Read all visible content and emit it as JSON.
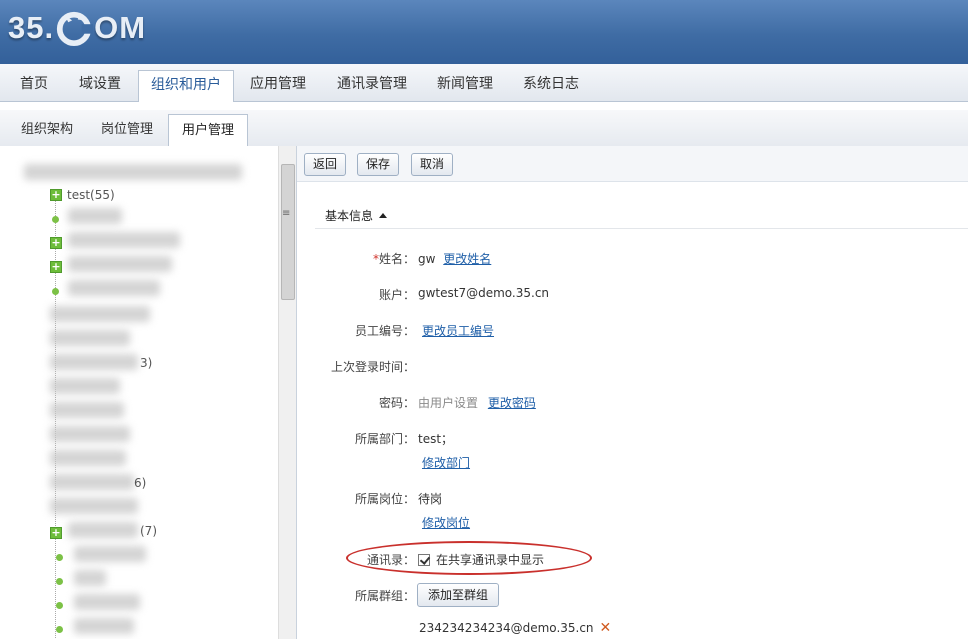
{
  "header": {
    "logo_left": "35.",
    "logo_right": "OM"
  },
  "main_nav": {
    "tabs": [
      "首页",
      "域设置",
      "组织和用户",
      "应用管理",
      "通讯录管理",
      "新闻管理",
      "系统日志"
    ],
    "active_index": 2
  },
  "sub_nav": {
    "tabs": [
      "组织架构",
      "岗位管理",
      "用户管理"
    ],
    "active_index": 2
  },
  "tree": {
    "visible_node": "test(55)",
    "partial_counts": [
      "3)",
      "6)",
      "(7)"
    ]
  },
  "toolbar": {
    "back": "返回",
    "save": "保存",
    "cancel": "取消"
  },
  "section": {
    "title": "基本信息"
  },
  "form": {
    "name": {
      "required_mark": "*",
      "label": "姓名：",
      "value": "gw",
      "link": "更改姓名"
    },
    "account": {
      "label": "账户：",
      "value": "gwtest7@demo.35.cn"
    },
    "employee_no": {
      "label": "员工编号：",
      "link": "更改员工编号"
    },
    "last_login": {
      "label": "上次登录时间："
    },
    "password": {
      "label": "密码：",
      "value": "由用户设置",
      "link": "更改密码"
    },
    "department": {
      "label": "所属部门：",
      "value": "test；",
      "link": "修改部门"
    },
    "position": {
      "label": "所属岗位：",
      "value": "待岗",
      "link": "修改岗位"
    },
    "contacts": {
      "label": "通讯录：",
      "checkbox_label": "在共享通讯录中显示",
      "checked": true
    },
    "groups": {
      "label": "所属群组：",
      "button": "添加至群组",
      "member": "234234234234@demo.35.cn"
    }
  },
  "colors": {
    "header": "#3f6ca4",
    "link": "#1f5fa8",
    "highlight": "#c9302c"
  }
}
